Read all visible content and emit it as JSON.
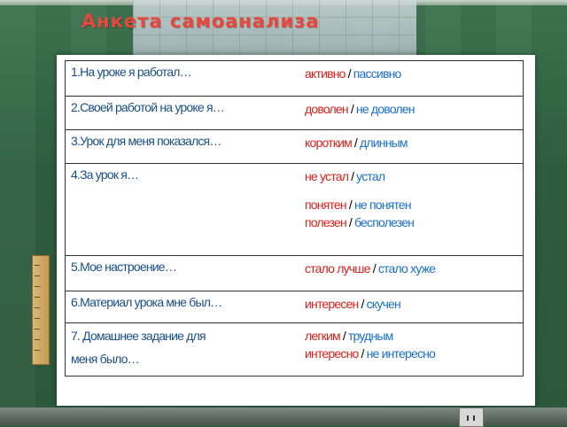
{
  "title": "Анкета самоанализа",
  "rows": [
    {
      "q": "1.На уроке я работал…",
      "a": [
        [
          "активно",
          "пассивно"
        ]
      ]
    },
    {
      "q": "2.Своей работой на уроке я…",
      "a": [
        [
          "доволен",
          "не доволен"
        ]
      ]
    },
    {
      "q": "3.Урок для меня показался…",
      "a": [
        [
          "коротким",
          "длинным"
        ]
      ]
    },
    {
      "q": "4.За урок я…",
      "a": [
        [
          "не устал",
          "устал"
        ],
        [
          "понятен",
          "не понятен"
        ],
        [
          "полезен",
          "бесполезен"
        ]
      ]
    },
    {
      "q": "5.Мое настроение…",
      "a": [
        [
          "стало лучше",
          "стало хуже"
        ]
      ]
    },
    {
      "q": "6.Материал урока мне был…",
      "a": [
        [
          "интересен",
          "скучен"
        ]
      ]
    },
    {
      "q": "7. Домашнее задание  для",
      "q2": "меня было…",
      "a": [
        [
          "легким",
          "трудным"
        ],
        [
          "интересно",
          "не интересно"
        ]
      ]
    }
  ],
  "separator": "/",
  "colors": {
    "positive": "#d8211c",
    "negative": "#1a6fc7",
    "question": "#1a4f86",
    "title": "#e8473b"
  }
}
